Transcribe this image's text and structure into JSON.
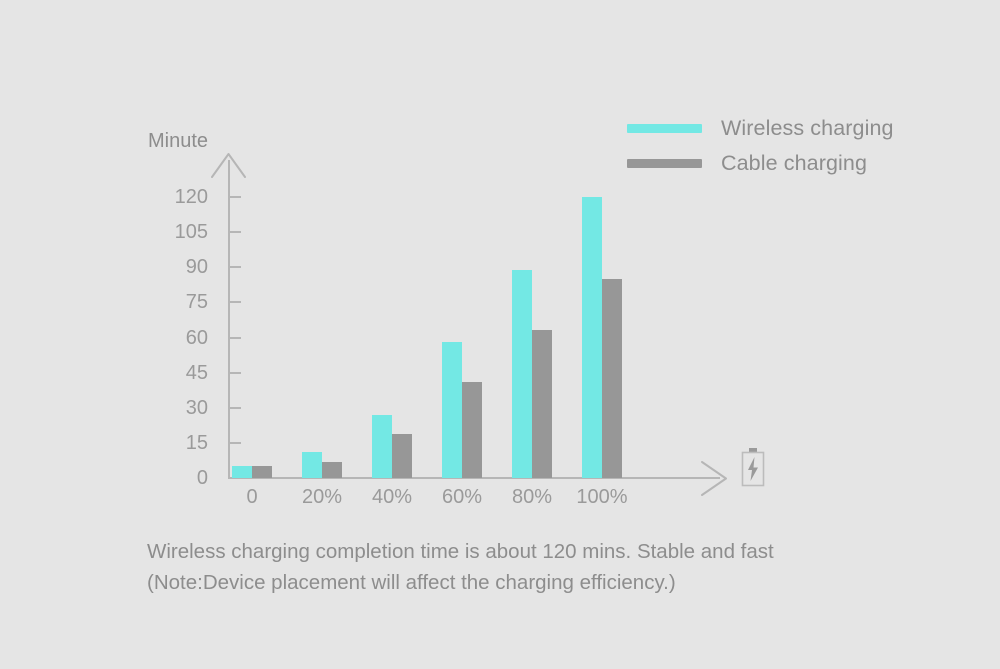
{
  "colors": {
    "background": "#e5e5e5",
    "wireless": "#73e8e4",
    "cable": "#979797",
    "axis": "#b6b6b6",
    "text": "#8d8d8d",
    "tick_text": "#9a9a9a"
  },
  "legend": {
    "items": [
      {
        "label": "Wireless charging",
        "color": "#73e8e4",
        "series": "wireless"
      },
      {
        "label": "Cable charging",
        "color": "#979797",
        "series": "cable"
      }
    ]
  },
  "caption": {
    "line1": "Wireless charging completion time is about 120 mins. Stable and fast",
    "line2": "(Note:Device placement will affect the charging efficiency.)"
  },
  "icons": {
    "battery_charging": "battery-charging-icon",
    "y_axis_arrow": "arrow-up-icon",
    "x_axis_arrow": "arrow-right-icon"
  },
  "chart_data": {
    "type": "bar",
    "title": "",
    "subtitle": "",
    "xlabel": "",
    "ylabel": "Minute",
    "ylim": [
      0,
      135
    ],
    "yticks": [
      0,
      15,
      30,
      45,
      60,
      75,
      90,
      105,
      120
    ],
    "ytick_labels": [
      "0",
      "15",
      "30",
      "45",
      "60",
      "75",
      "90",
      "105",
      "120"
    ],
    "grid": false,
    "legend_position": "top-right",
    "categories": [
      "0",
      "20%",
      "40%",
      "60%",
      "80%",
      "100%"
    ],
    "series": [
      {
        "name": "Wireless charging",
        "color": "#73e8e4",
        "values": [
          5,
          11,
          27,
          58,
          89,
          120
        ]
      },
      {
        "name": "Cable charging",
        "color": "#979797",
        "values": [
          5,
          7,
          19,
          41,
          63,
          85
        ]
      }
    ],
    "annotations": [
      "Wireless charging completion time is about 120 mins. Stable and fast",
      "(Note:Device placement will affect the charging efficiency.)"
    ]
  }
}
